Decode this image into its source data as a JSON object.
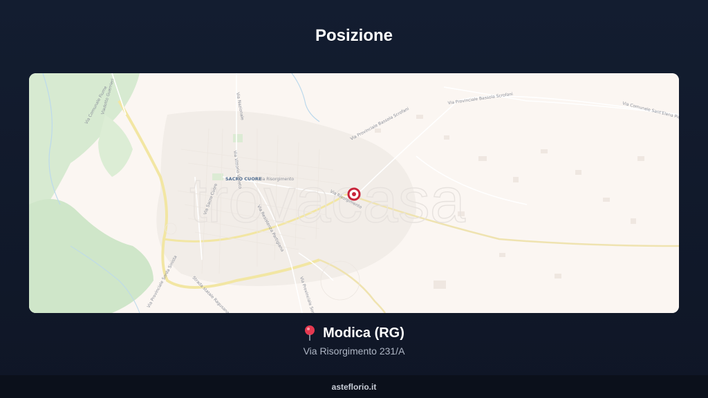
{
  "header": {
    "title": "Posizione"
  },
  "map": {
    "watermark": "trovacasa",
    "district_label": "SACRO CUORE",
    "street_labels": {
      "risorgimento_w": "Via Risorgimento",
      "risorgimento_e": "Via Risorgimento",
      "scrofani_n": "Via Provinciale Bassola Scrofani",
      "scrofani_ne": "Via Provinciale Bassola Scrofani",
      "sant_elena": "Via Comunale Sant'Elena Pietra Nera",
      "nazionale": "Via Nazionale",
      "vittorio_veneto": "Via Vittorio Veneto",
      "resistenza": "Via Resistenza Partigiana",
      "sorda": "Via Provinciale Sorda Sampieri",
      "statale_sud": "Via Provinciale Sorda Sinista",
      "ragusana": "Strada statale Ragusana",
      "viadotto": "Viadotto Guerrieri",
      "comunale_fiume": "Via Comunale Fiume",
      "staz": "Via Sacro Cuore"
    },
    "accent": "#c8243a",
    "roads_color": "#f3e7a6",
    "park_color": "#d5e9cf"
  },
  "location": {
    "icon": "pin-icon",
    "city": "Modica (RG)",
    "address": "Via Risorgimento 231/A"
  },
  "footer": {
    "brand": "asteflorio.it"
  }
}
